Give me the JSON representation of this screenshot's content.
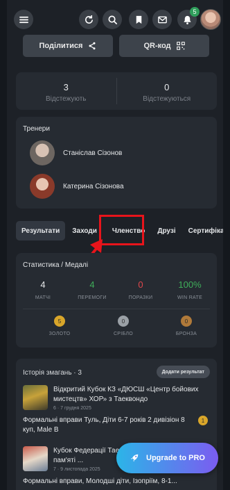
{
  "topbar": {
    "notifications_count": "5"
  },
  "actions": {
    "share_label": "Поділитися",
    "qr_label": "QR-код"
  },
  "follow": {
    "following_count": "3",
    "following_label": "Відстежують",
    "followed_count": "0",
    "followed_label": "Відстежуються"
  },
  "coaches": {
    "title": "Тренери",
    "items": [
      {
        "name": "Станіслав Сізонов"
      },
      {
        "name": "Катерина Сізонова"
      }
    ]
  },
  "tabs": [
    "Результати",
    "Заходи",
    "Членство",
    "Друзі",
    "Сертифікати"
  ],
  "stats": {
    "title": "Статистика / Медалі",
    "metrics": [
      {
        "value": "4",
        "label": "МАТЧІ",
        "color": "#e6e8ea"
      },
      {
        "value": "4",
        "label": "ПЕРЕМОГИ",
        "color": "#3fae5a"
      },
      {
        "value": "0",
        "label": "ПОРАЗКИ",
        "color": "#e0474c"
      },
      {
        "value": "100%",
        "label": "WIN RATE",
        "color": "#3fae5a"
      }
    ],
    "medals": [
      {
        "count": "5",
        "label": "ЗОЛОТО",
        "color": "#d9a62a"
      },
      {
        "count": "0",
        "label": "СРІБЛО",
        "color": "#9aa0a6"
      },
      {
        "count": "0",
        "label": "БРОНЗА",
        "color": "#b07a3a"
      }
    ]
  },
  "history": {
    "title": "Історія змагань · 3",
    "add_label": "Додати результат",
    "events": [
      {
        "title": "Відкритий Кубок КЗ «ДЮСШ «Центр бойових мистецтв» ХОР» з Таеквондо",
        "date": "6 · 7 грудня 2025"
      },
      {
        "title": "Формальні вправи Туль, Діти 6-7 років 2 дивізіон 8 куп, Male B",
        "medal": "1"
      },
      {
        "title": "Кубок Федерації Таеквондо ... присвячений пам'яті ...",
        "date": "7 · 9 листопада 2025"
      },
      {
        "title": "Формальні вправи, Молодші діти, Ізопріїм, 8-1..."
      }
    ]
  },
  "upgrade": {
    "label": "Upgrade to PRO"
  },
  "colors": {
    "highlight": "#e8141b",
    "accent_start": "#2bb5e8",
    "accent_end": "#7b5cf0"
  }
}
